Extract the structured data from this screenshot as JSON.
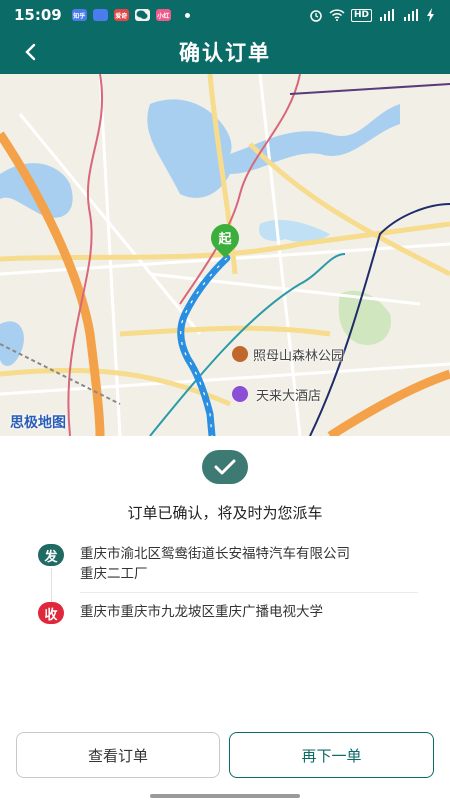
{
  "status_bar": {
    "time": "15:09",
    "app_icons": [
      "知乎",
      "",
      "爱奇",
      "",
      "小红"
    ],
    "network": "4G",
    "hd": "HD"
  },
  "nav": {
    "title": "确认订单",
    "back_icon": "chevron-left-icon"
  },
  "map": {
    "start_marker": "起",
    "pois": [
      {
        "name": "照母山森林公园",
        "icon": "park-icon"
      },
      {
        "name": "天来大酒店",
        "icon": "hotel-icon"
      }
    ],
    "brand": "思极地图"
  },
  "order": {
    "confirm_icon": "check-icon",
    "confirm_message": "订单已确认，将及时为您派车",
    "from": {
      "badge": "发",
      "address_line1": "重庆市渝北区鸳鸯街道长安福特汽车有限公司",
      "address_line2": "重庆二工厂"
    },
    "to": {
      "badge": "收",
      "address": "重庆市重庆市九龙坡区重庆广播电视大学"
    }
  },
  "actions": {
    "view_order": "查看订单",
    "order_again": "再下一单"
  },
  "colors": {
    "primary": "#0b6b66",
    "from_badge": "#1f6b63",
    "to_badge": "#e0283d",
    "route": "#2a8fe0"
  }
}
